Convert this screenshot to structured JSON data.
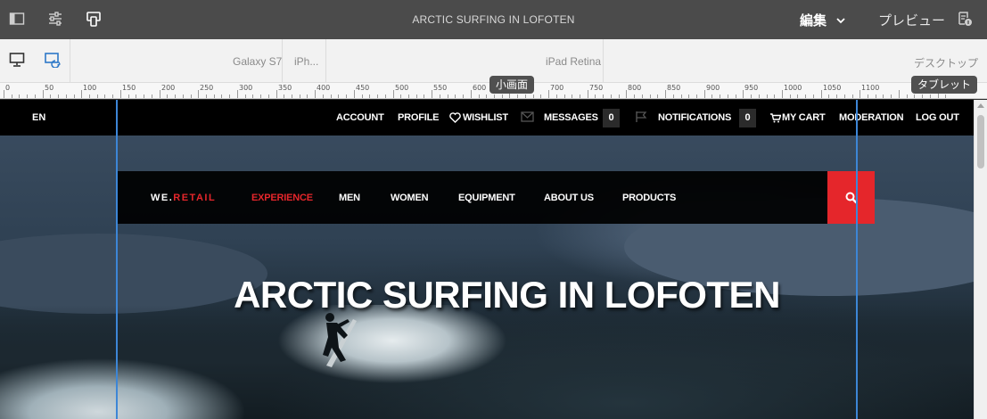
{
  "editor": {
    "page_title": "ARCTIC SURFING IN LOFOTEN",
    "edit_label": "編集",
    "preview_label": "プレビュー",
    "icons": [
      "side-panel-icon",
      "page-properties-icon",
      "emulator-icon",
      "chevron-down-icon",
      "page-information-icon"
    ]
  },
  "emulator": {
    "devices": [
      "Galaxy S7",
      "iPh...",
      "iPad Retina",
      "デスクトップ"
    ],
    "ruler_marks": [
      "0",
      "50",
      "100",
      "150",
      "200",
      "250",
      "300",
      "350",
      "400",
      "450",
      "500",
      "550",
      "600",
      "650",
      "700",
      "750",
      "800",
      "850",
      "900",
      "950",
      "1000",
      "1050",
      "1100"
    ],
    "breakpoint_tooltips": {
      "small": "小画面",
      "tablet": "タブレット"
    }
  },
  "site": {
    "language": "EN",
    "util_nav": {
      "account": "ACCOUNT",
      "profile": "PROFILE",
      "wishlist": "WISHLIST",
      "messages": "MESSAGES",
      "messages_count": "0",
      "notifications": "NOTIFICATIONS",
      "notifications_count": "0",
      "cart": "MY CART",
      "moderation": "MODERATION",
      "logout": "LOG OUT"
    },
    "logo": {
      "part1": "WE.",
      "part2": "RETAIL"
    },
    "main_nav": [
      "EXPERIENCE",
      "MEN",
      "WOMEN",
      "EQUIPMENT",
      "ABOUT US",
      "PRODUCTS"
    ],
    "hero_title": "ARCTIC SURFING IN LOFOTEN"
  },
  "colors": {
    "accent": "#e5262b",
    "guide": "#3d86d6",
    "toolbar": "#4b4b4b"
  }
}
